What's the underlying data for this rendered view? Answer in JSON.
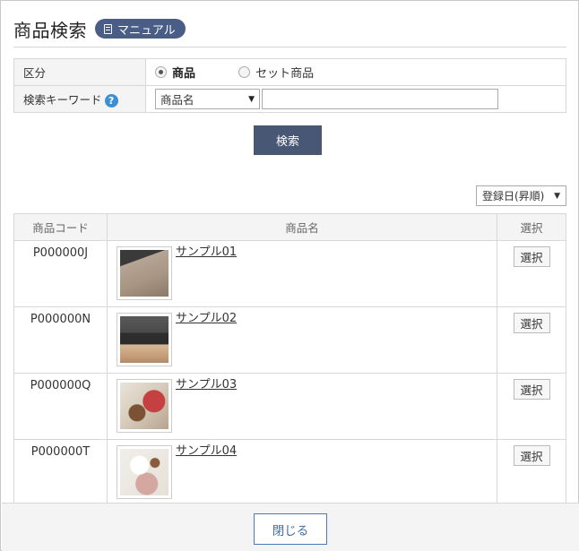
{
  "header": {
    "title": "商品検索",
    "manual_label": "マニュアル"
  },
  "search_form": {
    "category_label": "区分",
    "category_options": [
      {
        "label": "商品",
        "selected": true
      },
      {
        "label": "セット商品",
        "selected": false
      }
    ],
    "keyword_label": "検索キーワード",
    "keyword_field_selected": "商品名",
    "keyword_value": "",
    "help_glyph": "?",
    "search_button": "検索"
  },
  "sort": {
    "selected": "登録日(昇順)"
  },
  "results": {
    "columns": [
      "商品コード",
      "商品名",
      "選択"
    ],
    "rows": [
      {
        "code": "P000000J",
        "name": "サンプル01",
        "select_label": "選択"
      },
      {
        "code": "P000000N",
        "name": "サンプル02",
        "select_label": "選択"
      },
      {
        "code": "P000000Q",
        "name": "サンプル03",
        "select_label": "選択"
      },
      {
        "code": "P000000T",
        "name": "サンプル04",
        "select_label": "選択"
      }
    ]
  },
  "footer": {
    "close_label": "閉じる"
  },
  "colors": {
    "manual_badge": "#4a5d86",
    "search_button": "#485774",
    "help_icon": "#3c8fd6",
    "close_border": "#4a79b5"
  }
}
